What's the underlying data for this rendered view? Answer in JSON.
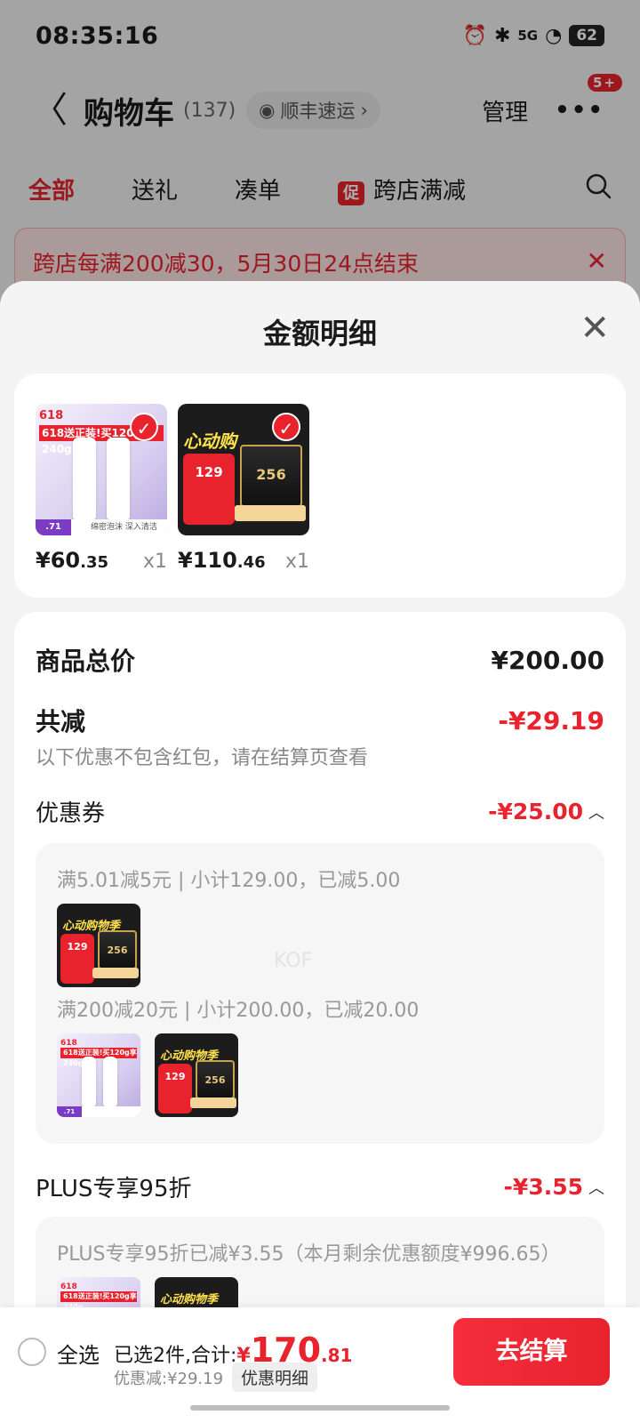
{
  "status_bar": {
    "time": "08:35:16",
    "network": "5G",
    "battery": "62"
  },
  "header": {
    "title": "购物车",
    "count": "(137)",
    "shipping_pill": "顺丰速运",
    "manage": "管理",
    "more_badge": "5+"
  },
  "tabs": [
    {
      "label": "全部",
      "active": true
    },
    {
      "label": "送礼"
    },
    {
      "label": "凑单"
    },
    {
      "label": "跨店满减",
      "tag": "促"
    }
  ],
  "banner": {
    "text": "跨店每满200减30，5月30日24点结束"
  },
  "sheet": {
    "title": "金额明细",
    "products": [
      {
        "price_int": "¥60",
        "price_dec": ".35",
        "qty": "x1",
        "image": "facial-cleanser"
      },
      {
        "price_int": "¥110",
        "price_dec": ".46",
        "qty": "x1",
        "image": "memory-card"
      }
    ],
    "summary": {
      "total_label": "商品总价",
      "total_value": "¥200.00",
      "discount_label": "共减",
      "discount_value": "-¥29.19",
      "discount_note": "以下优惠不包含红包，请在结算页查看"
    },
    "coupon": {
      "label": "优惠券",
      "value": "-¥25.00",
      "rules": [
        {
          "text": "满5.01减5元 | 小计129.00，已减5.00"
        },
        {
          "text": "满200减20元 | 小计200.00，已减20.00"
        }
      ]
    },
    "plus": {
      "label": "PLUS专享95折",
      "value": "-¥3.55",
      "detail": "PLUS专享95折已减¥3.55（本月剩余优惠额度¥996.65）"
    },
    "watermark": "KOF"
  },
  "product_art": {
    "a_tag": "618",
    "a_promo": "618送正装!买120g享240g",
    "a_footer": "绵密泡沫 深入清洁",
    "a_price": ".71",
    "b_heart": "心动购物季",
    "b_price": "129",
    "b_card": "256"
  },
  "bottom_bar": {
    "select_all": "全选",
    "selected": "已选2件,合计:",
    "currency": "¥",
    "total_int": "170",
    "total_dec": ".81",
    "discount": "优惠减:¥29.19",
    "detail_button": "优惠明细",
    "checkout": "去结算"
  },
  "colors": {
    "accent": "#e8232e",
    "sheet_bg": "#f4f4f4"
  }
}
